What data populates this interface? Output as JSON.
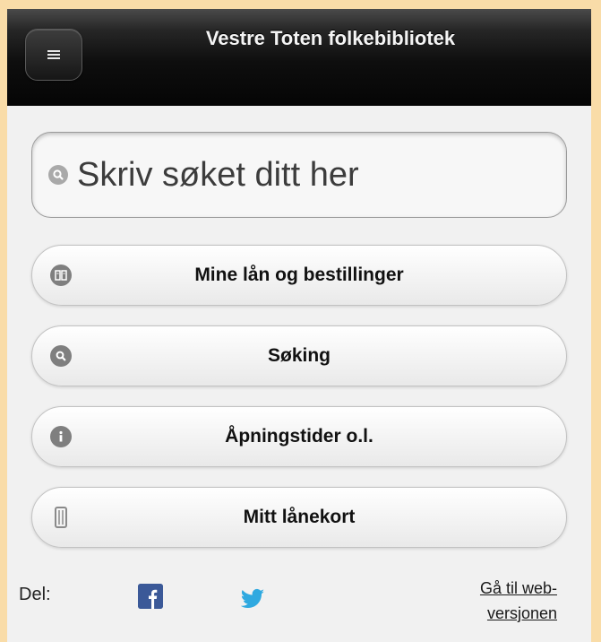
{
  "header": {
    "title": "Vestre Toten folkebibliotek",
    "menu_icon": "hamburger-menu-icon"
  },
  "search": {
    "placeholder": "Skriv søket ditt her",
    "icon": "search-icon"
  },
  "menu": {
    "items": [
      {
        "label": "Mine lån og bestillinger",
        "icon": "loans-icon"
      },
      {
        "label": "Søking",
        "icon": "search-icon"
      },
      {
        "label": "Åpningstider o.l.",
        "icon": "info-icon"
      },
      {
        "label": "Mitt lånekort",
        "icon": "library-card-icon"
      }
    ]
  },
  "footer": {
    "share_label": "Del:",
    "share_icons": [
      "facebook-icon",
      "twitter-icon"
    ],
    "web_link_line1": "Gå til web-",
    "web_link_line2": "versjonen"
  },
  "colors": {
    "page_frame": "#f9dca8",
    "header_bg": "#0e0e0e",
    "header_text": "#f4f4f4",
    "content_bg": "#f1f1f1",
    "icon_gray": "#7f7f7f",
    "facebook_blue": "#3b5998",
    "twitter_blue": "#2fa9e0"
  }
}
